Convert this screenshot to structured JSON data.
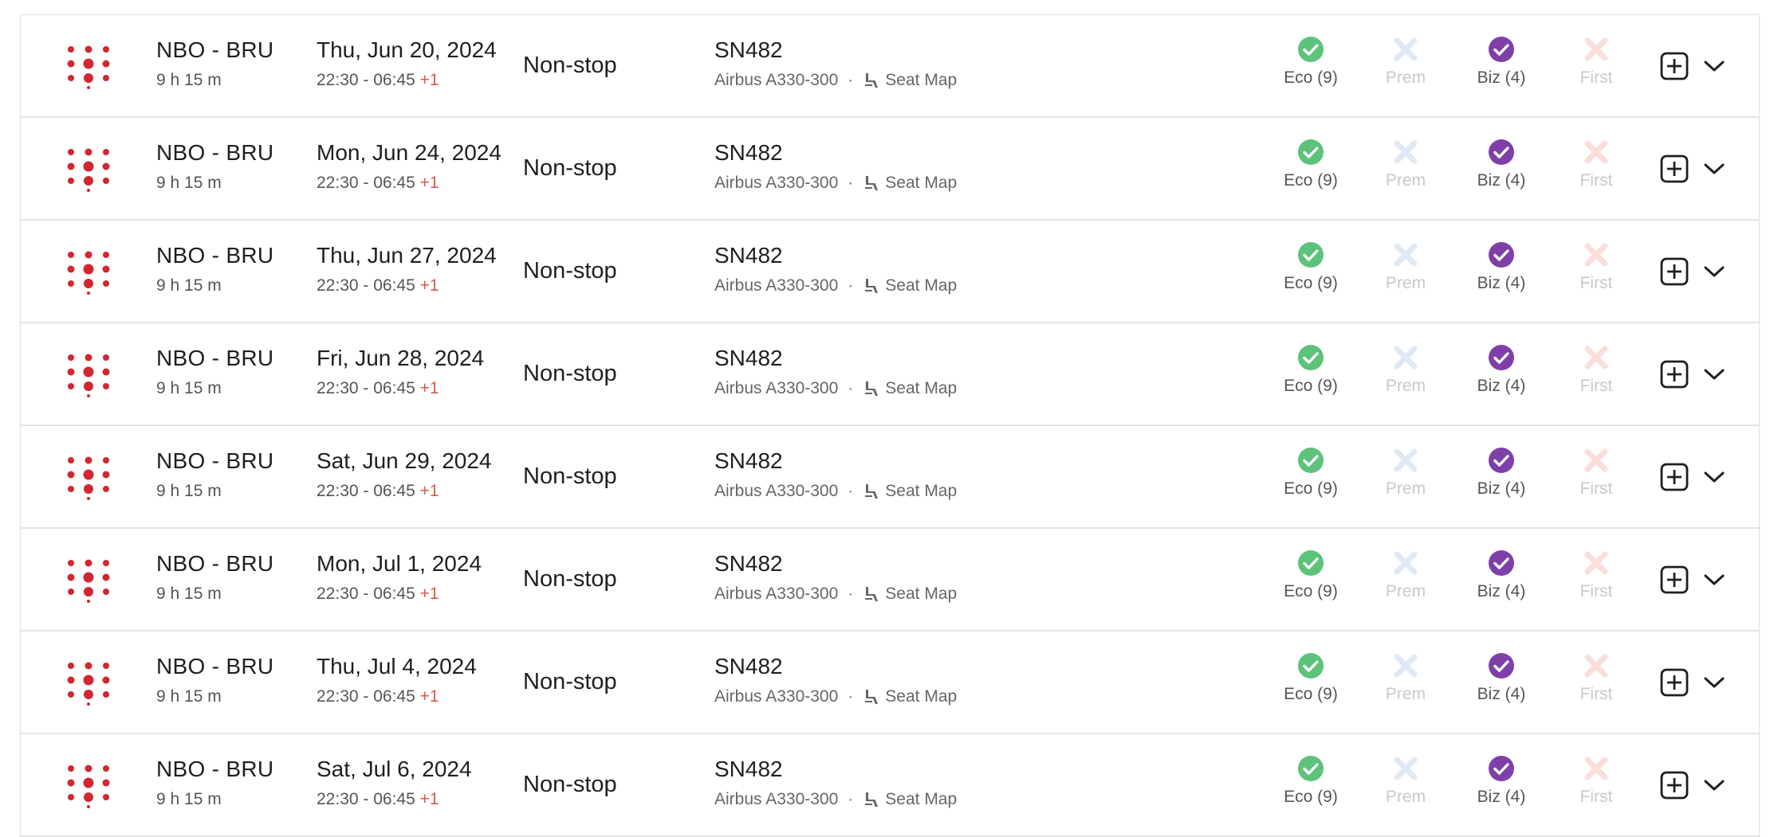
{
  "colors": {
    "brand_logo": "#d22630",
    "available_eco": "#5dc27a",
    "available_biz": "#7f3fa8",
    "unavailable_prem": "#dfe9f3",
    "unavailable_first": "#f9dedc",
    "red_day_offset": "#e0574a"
  },
  "icons": {
    "airline_logo": "airline-logo",
    "available": "check-circle-icon",
    "unavailable": "x-icon",
    "seat": "seat-icon",
    "add": "plus-square-icon",
    "expand": "chevron-down-icon"
  },
  "flights": [
    {
      "route": "NBO - BRU",
      "duration": "9 h 15 m",
      "date": "Thu, Jun 20, 2024",
      "times": "22:30 - 06:45 ",
      "day_offset": "+1",
      "stops": "Non-stop",
      "flight_number": "SN482",
      "aircraft": "Airbus A330-300",
      "separator": "·",
      "seat_map": "Seat Map",
      "cabins": {
        "eco": "Eco (9)",
        "prem": "Prem",
        "biz": "Biz (4)",
        "first": "First"
      }
    },
    {
      "route": "NBO - BRU",
      "duration": "9 h 15 m",
      "date": "Mon, Jun 24, 2024",
      "times": "22:30 - 06:45 ",
      "day_offset": "+1",
      "stops": "Non-stop",
      "flight_number": "SN482",
      "aircraft": "Airbus A330-300",
      "separator": "·",
      "seat_map": "Seat Map",
      "cabins": {
        "eco": "Eco (9)",
        "prem": "Prem",
        "biz": "Biz (4)",
        "first": "First"
      }
    },
    {
      "route": "NBO - BRU",
      "duration": "9 h 15 m",
      "date": "Thu, Jun 27, 2024",
      "times": "22:30 - 06:45 ",
      "day_offset": "+1",
      "stops": "Non-stop",
      "flight_number": "SN482",
      "aircraft": "Airbus A330-300",
      "separator": "·",
      "seat_map": "Seat Map",
      "cabins": {
        "eco": "Eco (9)",
        "prem": "Prem",
        "biz": "Biz (4)",
        "first": "First"
      }
    },
    {
      "route": "NBO - BRU",
      "duration": "9 h 15 m",
      "date": "Fri, Jun 28, 2024",
      "times": "22:30 - 06:45 ",
      "day_offset": "+1",
      "stops": "Non-stop",
      "flight_number": "SN482",
      "aircraft": "Airbus A330-300",
      "separator": "·",
      "seat_map": "Seat Map",
      "cabins": {
        "eco": "Eco (9)",
        "prem": "Prem",
        "biz": "Biz (4)",
        "first": "First"
      }
    },
    {
      "route": "NBO - BRU",
      "duration": "9 h 15 m",
      "date": "Sat, Jun 29, 2024",
      "times": "22:30 - 06:45 ",
      "day_offset": "+1",
      "stops": "Non-stop",
      "flight_number": "SN482",
      "aircraft": "Airbus A330-300",
      "separator": "·",
      "seat_map": "Seat Map",
      "cabins": {
        "eco": "Eco (9)",
        "prem": "Prem",
        "biz": "Biz (4)",
        "first": "First"
      }
    },
    {
      "route": "NBO - BRU",
      "duration": "9 h 15 m",
      "date": "Mon, Jul 1, 2024",
      "times": "22:30 - 06:45 ",
      "day_offset": "+1",
      "stops": "Non-stop",
      "flight_number": "SN482",
      "aircraft": "Airbus A330-300",
      "separator": "·",
      "seat_map": "Seat Map",
      "cabins": {
        "eco": "Eco (9)",
        "prem": "Prem",
        "biz": "Biz (4)",
        "first": "First"
      }
    },
    {
      "route": "NBO - BRU",
      "duration": "9 h 15 m",
      "date": "Thu, Jul 4, 2024",
      "times": "22:30 - 06:45 ",
      "day_offset": "+1",
      "stops": "Non-stop",
      "flight_number": "SN482",
      "aircraft": "Airbus A330-300",
      "separator": "·",
      "seat_map": "Seat Map",
      "cabins": {
        "eco": "Eco (9)",
        "prem": "Prem",
        "biz": "Biz (4)",
        "first": "First"
      }
    },
    {
      "route": "NBO - BRU",
      "duration": "9 h 15 m",
      "date": "Sat, Jul 6, 2024",
      "times": "22:30 - 06:45 ",
      "day_offset": "+1",
      "stops": "Non-stop",
      "flight_number": "SN482",
      "aircraft": "Airbus A330-300",
      "separator": "·",
      "seat_map": "Seat Map",
      "cabins": {
        "eco": "Eco (9)",
        "prem": "Prem",
        "biz": "Biz (4)",
        "first": "First"
      }
    }
  ]
}
